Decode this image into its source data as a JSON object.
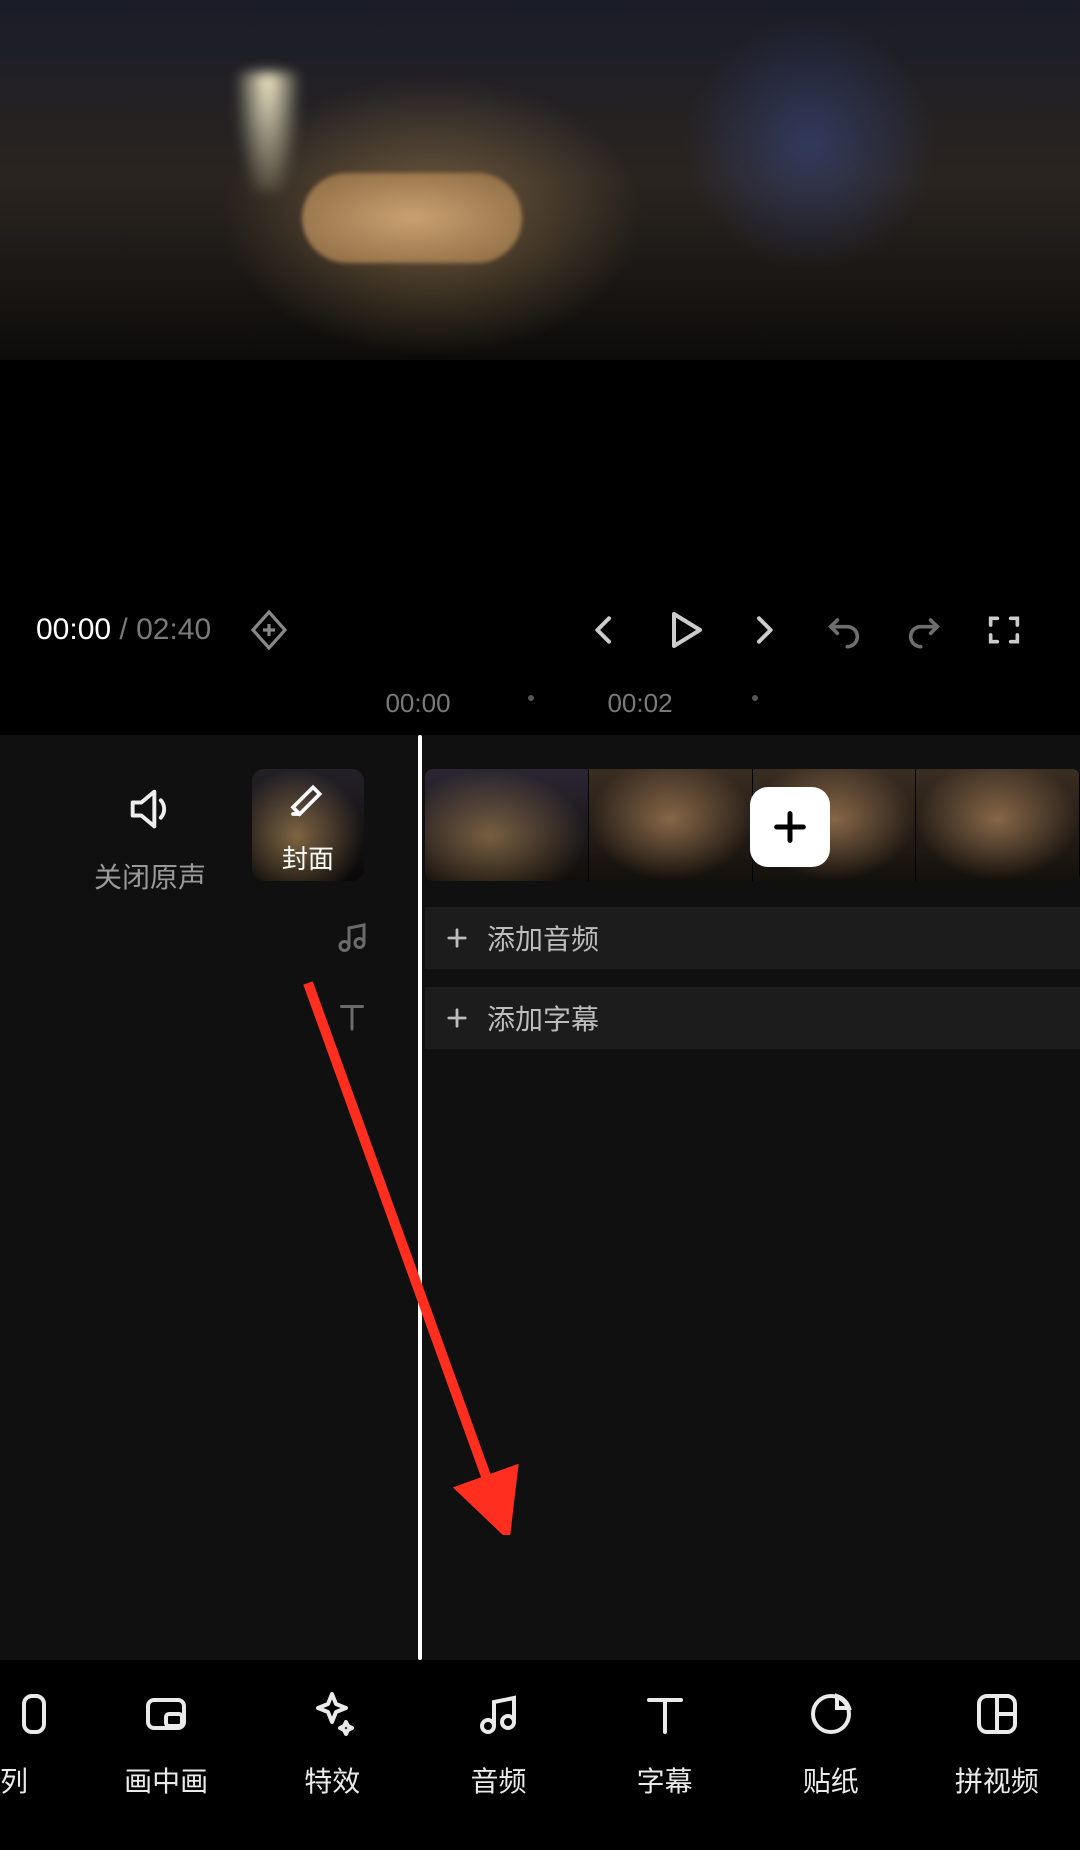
{
  "transport": {
    "current_time": "00:00",
    "separator": " / ",
    "duration": "02:40"
  },
  "ruler": {
    "t0": "00:00",
    "t1": "00:02"
  },
  "mute": {
    "label": "关闭原声"
  },
  "cover": {
    "label": "封面"
  },
  "tracks": {
    "add_audio": "添加音频",
    "add_subtitle": "添加字幕"
  },
  "toolbar": {
    "cut_partial": "列",
    "pip": "画中画",
    "effects": "特效",
    "audio": "音频",
    "subtitle": "字幕",
    "sticker": "贴纸",
    "collage": "拼视频"
  }
}
